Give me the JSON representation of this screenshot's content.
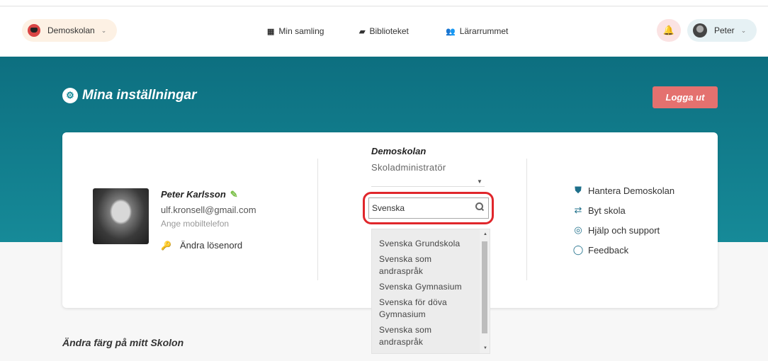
{
  "topbar": {
    "school_label": "Demoskolan",
    "nav": [
      {
        "icon": "grid-icon",
        "label": "Min samling"
      },
      {
        "icon": "book-icon",
        "label": "Biblioteket"
      },
      {
        "icon": "users-icon",
        "label": "Lärarrummet"
      }
    ],
    "user_label": "Peter"
  },
  "page": {
    "title": "Mina inställningar",
    "logout_label": "Logga ut",
    "subtitle": "Ändra färg på mitt Skolon"
  },
  "profile": {
    "name": "Peter Karlsson",
    "email": "ulf.kronsell@gmail.com",
    "phone_placeholder": "Ange mobiltelefon",
    "change_password": "Ändra lösenord"
  },
  "school_panel": {
    "school": "Demoskolan",
    "role": "Skoladministratör",
    "search_value": "Svenska",
    "options": [
      "Svenska Grundskola",
      "Svenska som andraspråk",
      "Svenska Gymnasium",
      "Svenska för döva Gymnasium",
      "Svenska som andraspråk"
    ]
  },
  "links": [
    {
      "icon": "shield-icon",
      "label": "Hantera Demoskolan"
    },
    {
      "icon": "switch-icon",
      "label": "Byt skola"
    },
    {
      "icon": "lifebuoy-icon",
      "label": "Hjälp och support"
    },
    {
      "icon": "chat-bubble-icon",
      "label": "Feedback"
    }
  ],
  "colors": {
    "accent": "#168a98",
    "logout": "#e4716f",
    "highlight": "#e0262b"
  }
}
